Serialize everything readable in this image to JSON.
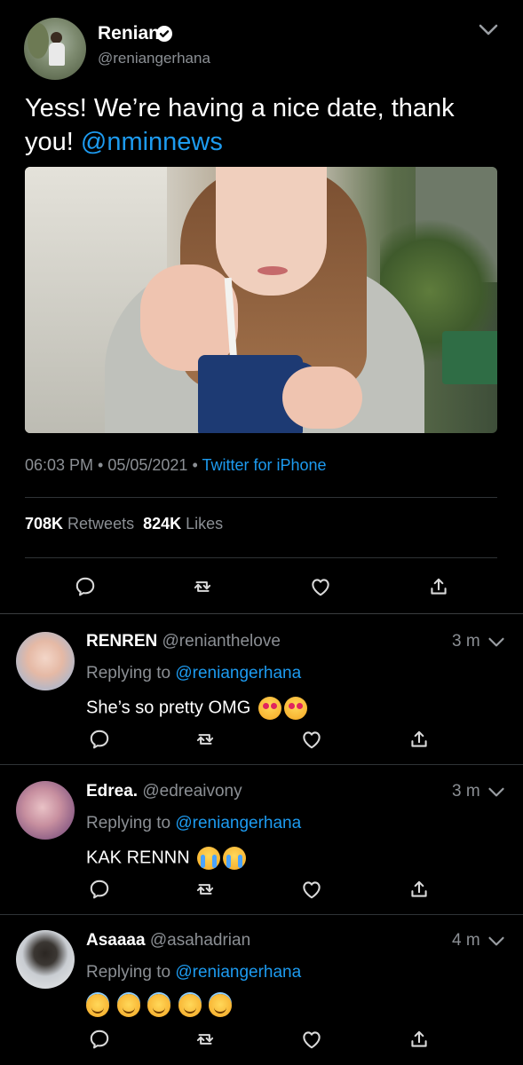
{
  "main_tweet": {
    "author_name": "Renian",
    "author_handle": "@reniangerhana",
    "text": "Yess! We’re having a nice date, thank you! ",
    "mention": "@nminnews",
    "time": "06:03 PM",
    "separator": " • ",
    "date": "05/05/2021",
    "source": "Twitter for iPhone",
    "retweets_count": "708K",
    "retweets_label": "Retweets",
    "likes_count": "824K",
    "likes_label": "Likes"
  },
  "replies": [
    {
      "name": "RENREN",
      "handle": "@renianthelove",
      "time": "3 m",
      "replying_label": "Replying to",
      "replying_to": "@reniangerhana",
      "text": "She’s so pretty OMG",
      "emojis": [
        "heart-eyes",
        "heart-eyes"
      ]
    },
    {
      "name": "Edrea.",
      "handle": "@edreaivony",
      "time": "3 m",
      "replying_label": "Replying to",
      "replying_to": "@reniangerhana",
      "text": "KAK RENNN",
      "emojis": [
        "crying",
        "crying"
      ]
    },
    {
      "name": "Asaaaa",
      "handle": "@asahadrian",
      "time": "4 m",
      "replying_label": "Replying to",
      "replying_to": "@reniangerhana",
      "text": "",
      "emojis": [
        "halo",
        "halo",
        "halo",
        "halo",
        "halo"
      ]
    }
  ],
  "colors": {
    "background": "#000000",
    "link": "#1d9bf0",
    "muted": "#8b8f94",
    "divider": "#2f3336"
  },
  "icons": [
    "verified-badge-icon",
    "chevron-down-icon",
    "reply-icon",
    "retweet-icon",
    "like-icon",
    "share-icon"
  ]
}
